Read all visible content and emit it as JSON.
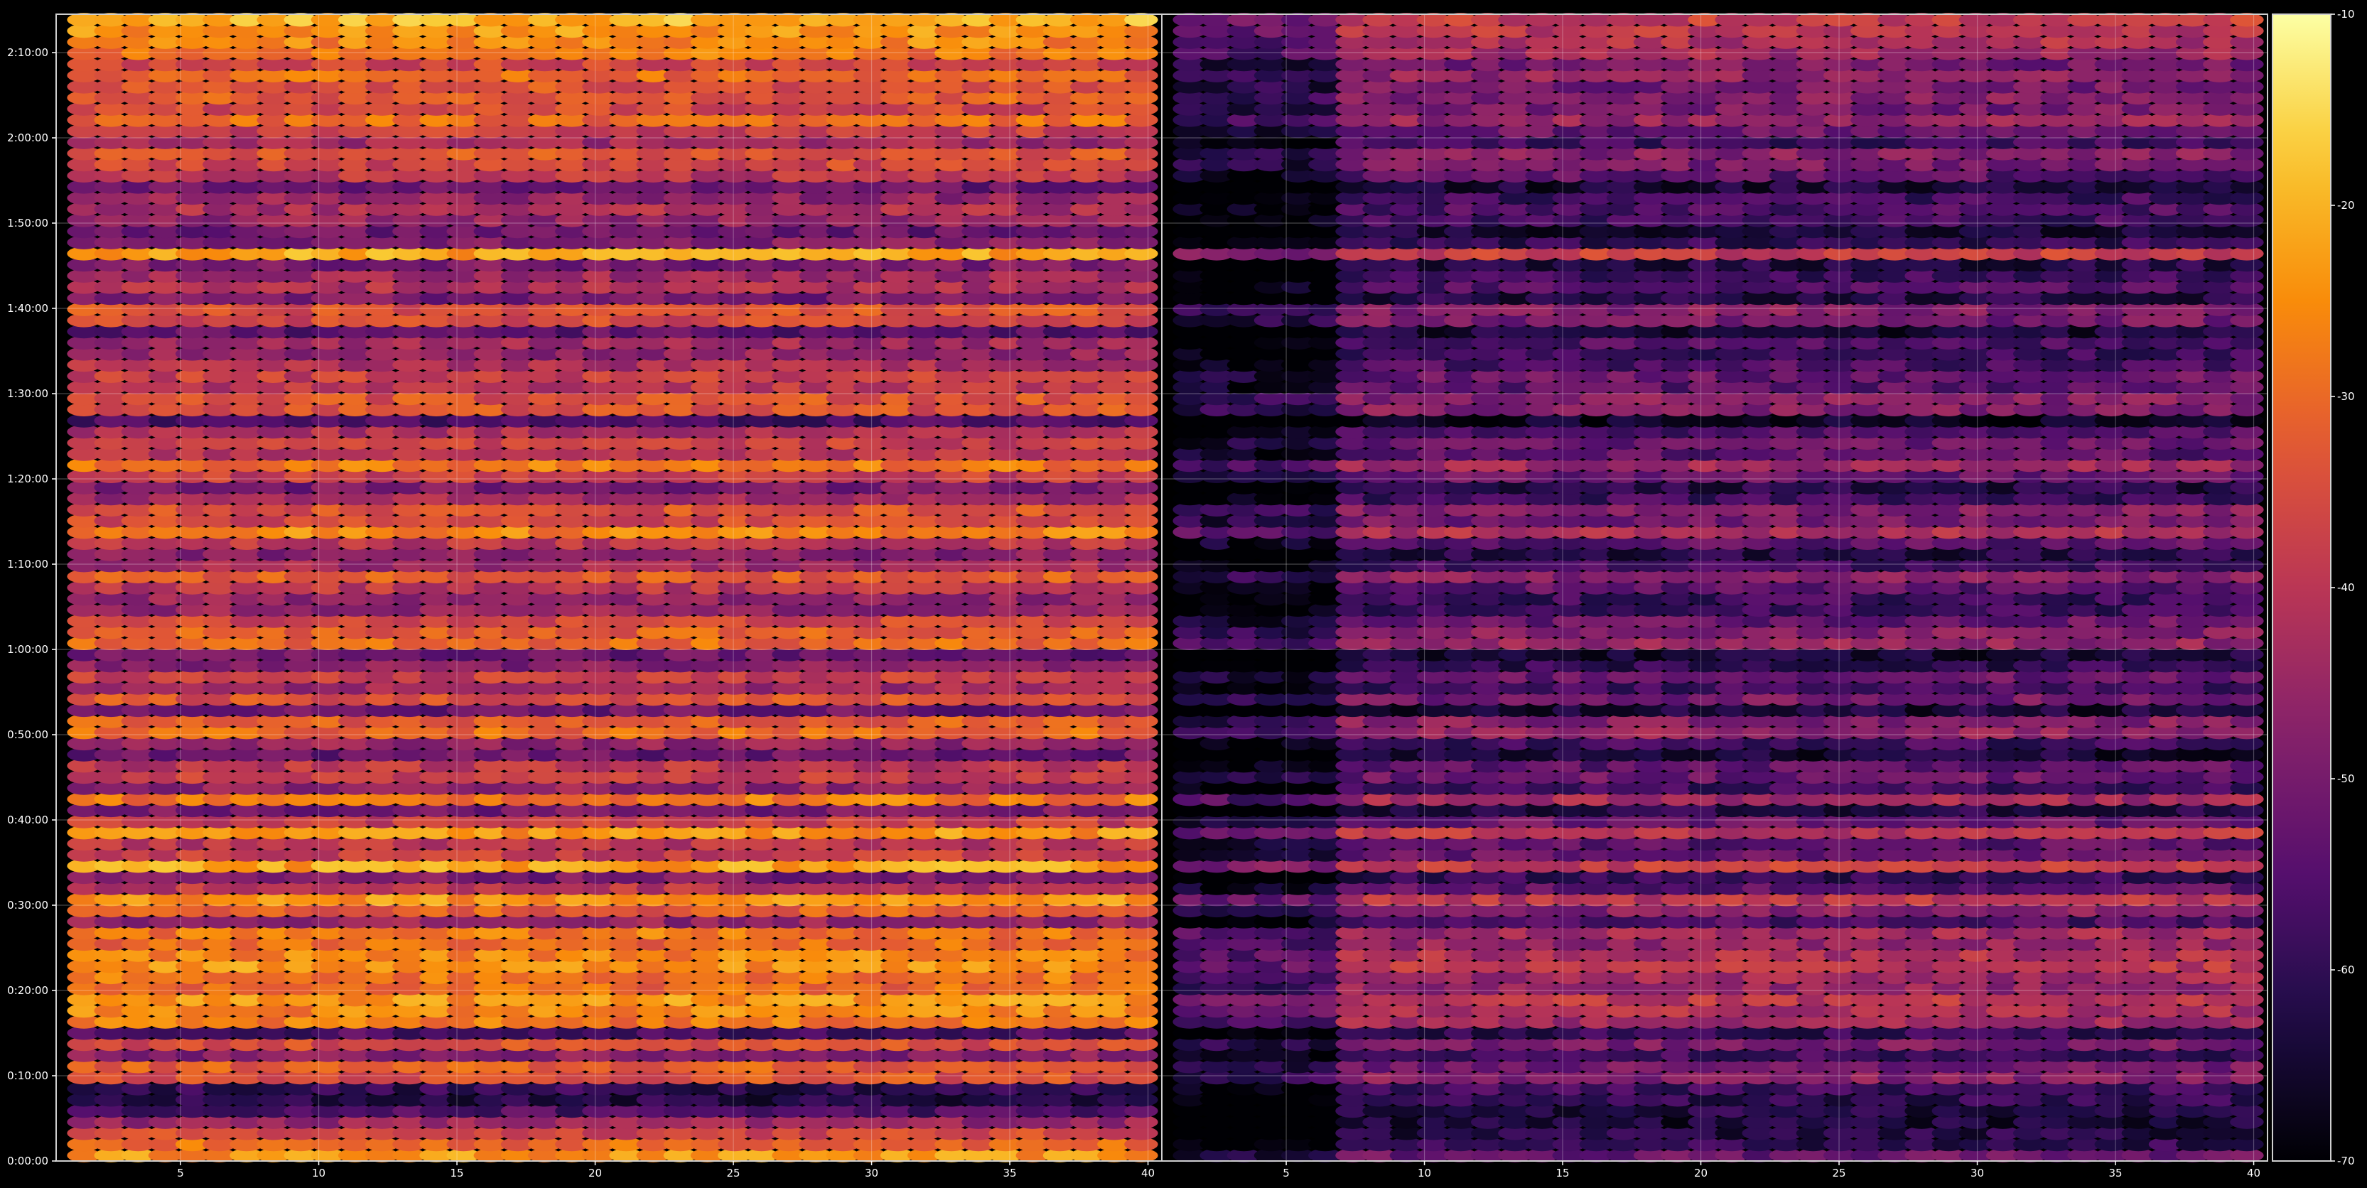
{
  "chart_data": {
    "type": "heatmap",
    "title": "",
    "xlabel": "",
    "ylabel": "",
    "panels": [
      {
        "name": "",
        "x_range": [
          1,
          40
        ],
        "x_ticks": [
          5,
          10,
          15,
          20,
          25,
          30,
          35,
          40
        ],
        "x_tick_labels": [
          "5",
          "10",
          "15",
          "20",
          "25",
          "30",
          "35",
          "40"
        ],
        "row_values": [
          -24,
          -30,
          -36,
          -45,
          -56,
          -62,
          -60,
          -34,
          -32,
          -48,
          -35,
          -56,
          -28,
          -26,
          -24,
          -30,
          -28,
          -24,
          -26,
          -30,
          -28,
          -46,
          -32,
          -24,
          -40,
          -50,
          -22,
          -38,
          -40,
          -24,
          -38,
          -50,
          -28,
          -46,
          -38,
          -40,
          -52,
          -46,
          -30,
          -32,
          -52,
          -34,
          -44,
          -38,
          -48,
          -52,
          -30,
          -32,
          -36,
          -46,
          -46,
          -40,
          -32,
          -44,
          -48,
          -40,
          -26,
          -36,
          -34,
          -44,
          -50,
          -38,
          -28,
          -40,
          -38,
          -42,
          -56,
          -34,
          -34,
          -40,
          -38,
          -42,
          -46,
          -44,
          -54,
          -36,
          -34,
          -50,
          -42,
          -44,
          -50,
          -22,
          -48,
          -52,
          -46,
          -42,
          -46,
          -52,
          -40,
          -36,
          -34,
          -44,
          -38,
          -30,
          -36,
          -32,
          -34,
          -30,
          -36,
          -28,
          -26,
          -24,
          -20
        ]
      },
      {
        "name": "",
        "x_range": [
          1,
          40
        ],
        "x_ticks": [
          5,
          10,
          15,
          20,
          25,
          30,
          35,
          40
        ],
        "x_tick_labels": [
          "5",
          "10",
          "15",
          "20",
          "25",
          "30",
          "35",
          "40"
        ],
        "row_values": [
          -52,
          -60,
          -62,
          -64,
          -62,
          -60,
          -58,
          -48,
          -50,
          -58,
          -50,
          -60,
          -44,
          -42,
          -40,
          -46,
          -44,
          -40,
          -42,
          -46,
          -44,
          -56,
          -48,
          -40,
          -54,
          -60,
          -38,
          -52,
          -54,
          -40,
          -52,
          -62,
          -44,
          -58,
          -52,
          -54,
          -64,
          -58,
          -46,
          -48,
          -64,
          -50,
          -58,
          -52,
          -60,
          -64,
          -46,
          -48,
          -52,
          -58,
          -58,
          -54,
          -48,
          -58,
          -62,
          -54,
          -42,
          -50,
          -48,
          -58,
          -62,
          -52,
          -44,
          -54,
          -52,
          -56,
          -66,
          -48,
          -48,
          -54,
          -52,
          -56,
          -58,
          -56,
          -64,
          -50,
          -48,
          -62,
          -56,
          -58,
          -62,
          -38,
          -60,
          -64,
          -58,
          -56,
          -58,
          -64,
          -54,
          -50,
          -48,
          -58,
          -52,
          -46,
          -50,
          -48,
          -50,
          -46,
          -50,
          -44,
          -42,
          -40,
          -38
        ]
      }
    ],
    "y_axis": {
      "range_seconds": [
        0,
        8070
      ],
      "ticks_seconds": [
        0,
        600,
        1200,
        1800,
        2400,
        3000,
        3600,
        4200,
        4800,
        5400,
        6000,
        6600,
        7200,
        7800
      ],
      "tick_labels": [
        "0:00:00",
        "0:10:00",
        "0:20:00",
        "0:30:00",
        "0:40:00",
        "0:50:00",
        "1:00:00",
        "1:10:00",
        "1:20:00",
        "1:30:00",
        "1:40:00",
        "1:50:00",
        "2:00:00",
        "2:10:00"
      ]
    },
    "colorbar": {
      "range": [
        -70,
        -10
      ],
      "ticks": [
        -10,
        -20,
        -30,
        -40,
        -50,
        -60,
        -70
      ],
      "tick_labels": [
        "-10",
        "-20",
        "-30",
        "-40",
        "-50",
        "-60",
        "-70"
      ],
      "colormap": "inferno"
    },
    "grid": true,
    "colors": {
      "background": "#000000",
      "axis": "#ffffff",
      "grid": "#ffffff"
    }
  }
}
